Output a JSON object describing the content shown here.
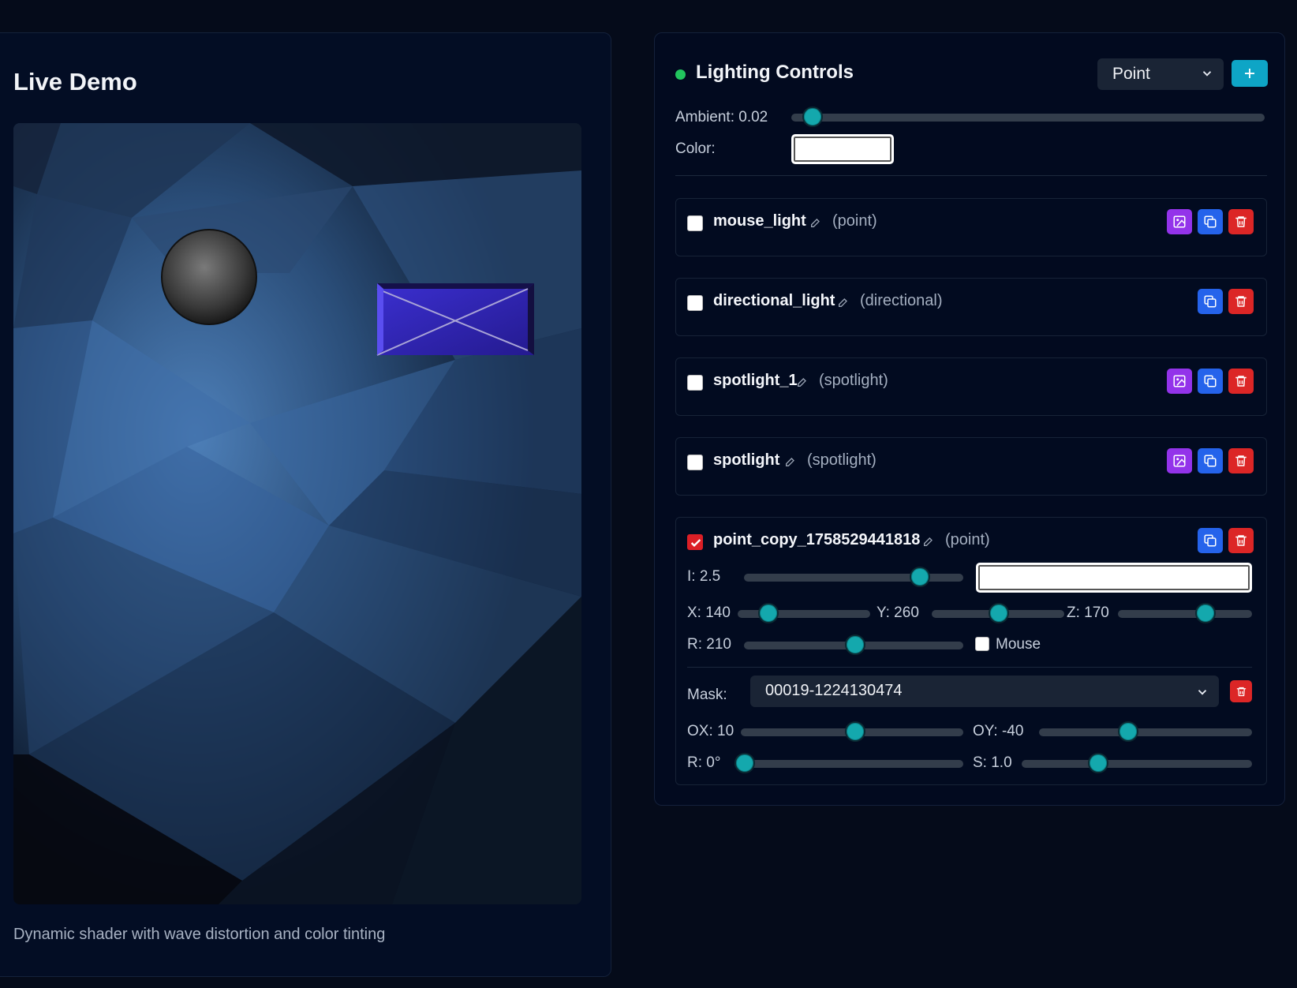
{
  "demo": {
    "title": "Live Demo",
    "caption": "Dynamic shader with wave distortion and color tinting"
  },
  "controls": {
    "title": "Lighting Controls",
    "type_select": "Point",
    "add_label": "+",
    "ambient": {
      "label": "Ambient: 0.02",
      "value": 0.02
    },
    "color_label": "Color:",
    "lights": [
      {
        "name": "mouse_light",
        "type": "(point)",
        "enabled": false,
        "has_image_btn": true
      },
      {
        "name": "directional_light",
        "type": "(directional)",
        "enabled": false,
        "has_image_btn": false
      },
      {
        "name": "spotlight_1",
        "type": "(spotlight)",
        "enabled": false,
        "has_image_btn": true
      },
      {
        "name": "spotlight",
        "type": "(spotlight)",
        "enabled": false,
        "has_image_btn": true
      },
      {
        "name": "point_copy_1758529441818",
        "type": "(point)",
        "enabled": true,
        "has_image_btn": false
      }
    ],
    "expanded": {
      "intensity_label": "I: 2.5",
      "x_label": "X: 140",
      "y_label": "Y: 260",
      "z_label": "Z: 170",
      "r_label": "R: 210",
      "mouse_label": "Mouse",
      "mask_label": "Mask:",
      "mask_value": "00019-1224130474",
      "ox_label": "OX: 10",
      "oy_label": "OY: -40",
      "rot_label": "R: 0°",
      "scale_label": "S: 1.0"
    }
  },
  "colors": {
    "accent": "#14a8ad",
    "add_button": "#0ea5c6",
    "image_button": "#9333ea",
    "copy_button": "#2563eb",
    "delete_button": "#dc2626",
    "status": "#22c55e"
  }
}
